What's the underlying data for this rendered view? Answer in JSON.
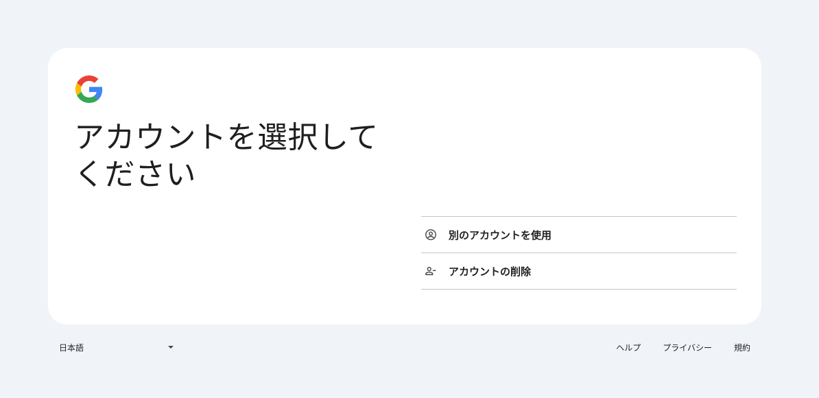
{
  "card": {
    "heading": "アカウントを選択してください"
  },
  "account_options": [
    {
      "label": "別のアカウントを使用",
      "icon": "account-circle-icon"
    },
    {
      "label": "アカウントの削除",
      "icon": "person-remove-icon"
    }
  ],
  "footer": {
    "language": "日本語",
    "links": {
      "help": "ヘルプ",
      "privacy": "プライバシー",
      "terms": "規約"
    }
  },
  "colors": {
    "background": "#f0f4f9",
    "card": "#ffffff",
    "divider": "#c4c7c5",
    "google_blue": "#4285F4",
    "google_red": "#EA4335",
    "google_yellow": "#FBBC05",
    "google_green": "#34A853"
  }
}
